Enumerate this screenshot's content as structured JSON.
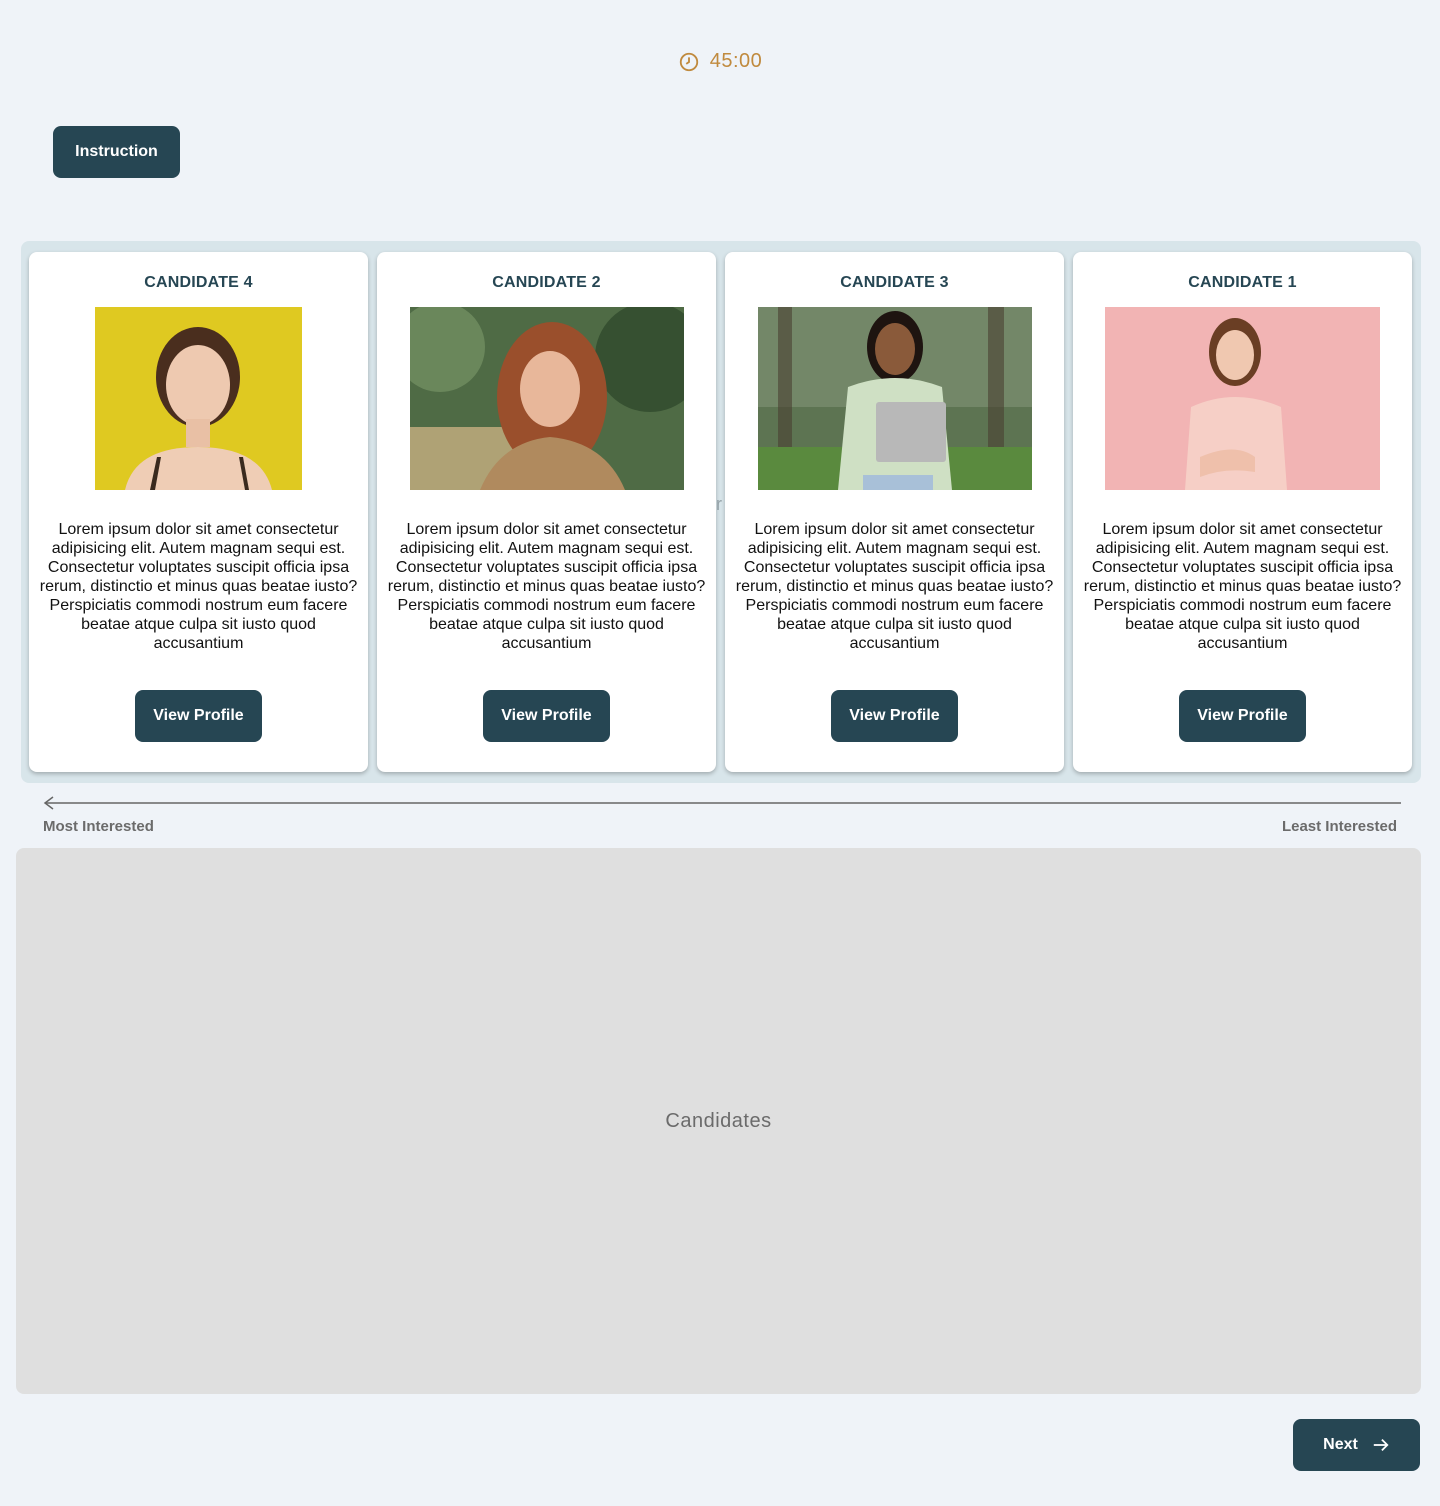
{
  "timer": {
    "value": "45:00",
    "icon": "clock-icon",
    "color": "#c08a3e"
  },
  "instruction_label": "Instruction",
  "board": {
    "ghost_text": "r"
  },
  "cards": [
    {
      "title": "CANDIDATE 4",
      "description": "Lorem ipsum dolor sit amet consectetur adipisicing elit. Autem magnam sequi est. Consectetur voluptates suscipit officia ipsa rerum, distinctio et minus quas beatae iusto? Perspiciatis commodi nostrum eum facere beatae atque culpa sit iusto quod accusantium",
      "button_label": "View Profile",
      "photo_bg": "#d9c21c"
    },
    {
      "title": "CANDIDATE 2",
      "description": "Lorem ipsum dolor sit amet consectetur adipisicing elit. Autem magnam sequi est. Consectetur voluptates suscipit officia ipsa rerum, distinctio et minus quas beatae iusto? Perspiciatis commodi nostrum eum facere beatae atque culpa sit iusto quod accusantium",
      "button_label": "View Profile",
      "photo_bg": "#4f6b45"
    },
    {
      "title": "CANDIDATE 3",
      "description": "Lorem ipsum dolor sit amet consectetur adipisicing elit. Autem magnam sequi est. Consectetur voluptates suscipit officia ipsa rerum, distinctio et minus quas beatae iusto? Perspiciatis commodi nostrum eum facere beatae atque culpa sit iusto quod accusantium",
      "button_label": "View Profile",
      "photo_bg": "#5d7452"
    },
    {
      "title": "CANDIDATE 1",
      "description": "Lorem ipsum dolor sit amet consectetur adipisicing elit. Autem magnam sequi est. Consectetur voluptates suscipit officia ipsa rerum, distinctio et minus quas beatae iusto? Perspiciatis commodi nostrum eum facere beatae atque culpa sit iusto quod accusantium",
      "button_label": "View Profile",
      "photo_bg": "#f2b4b4"
    }
  ],
  "scale": {
    "left_label": "Most Interested",
    "right_label": "Least Interested"
  },
  "dropzone_label": "Candidates",
  "next_label": "Next",
  "colors": {
    "primary": "#264653",
    "background": "#eff3f8",
    "board": "#d8e5ea",
    "dropzone": "#dfdfdf"
  }
}
